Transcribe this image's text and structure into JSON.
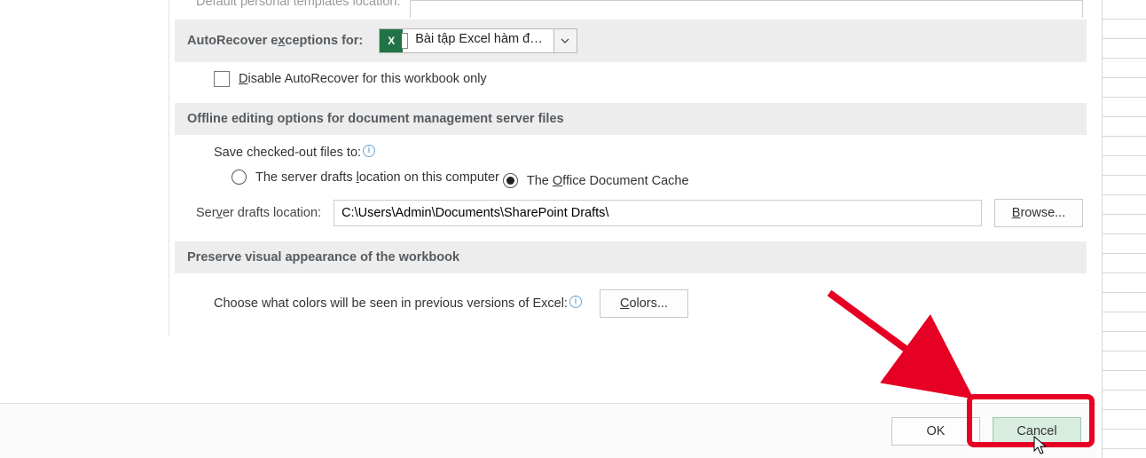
{
  "top_field": {
    "label_html": "Default personal templates location:"
  },
  "section_autorecover": {
    "title_pre": "AutoRecover e",
    "title_u": "x",
    "title_post": "ceptions for:",
    "workbook_name": "Bài tập Excel hàm đ…",
    "disable_pre": "",
    "disable_u": "D",
    "disable_post": "isable AutoRecover for this workbook only"
  },
  "section_offline": {
    "title": "Offline editing options for document management server files",
    "save_to_label": "Save checked-out files to:",
    "radio1_pre": "The server drafts ",
    "radio1_u": "l",
    "radio1_post": "ocation on this computer",
    "radio2_pre": "The ",
    "radio2_u": "O",
    "radio2_post": "ffice Document Cache",
    "drafts_label_pre": "Ser",
    "drafts_label_u": "v",
    "drafts_label_post": "er drafts location:",
    "drafts_value": "C:\\Users\\Admin\\Documents\\SharePoint Drafts\\",
    "browse_pre": "",
    "browse_u": "B",
    "browse_post": "rowse..."
  },
  "section_preserve": {
    "title": "Preserve visual appearance of the workbook",
    "color_label": "Choose what colors will be seen in previous versions of Excel:",
    "colors_btn_u": "C",
    "colors_btn_post": "olors..."
  },
  "footer": {
    "ok": "OK",
    "cancel": "Cancel"
  }
}
